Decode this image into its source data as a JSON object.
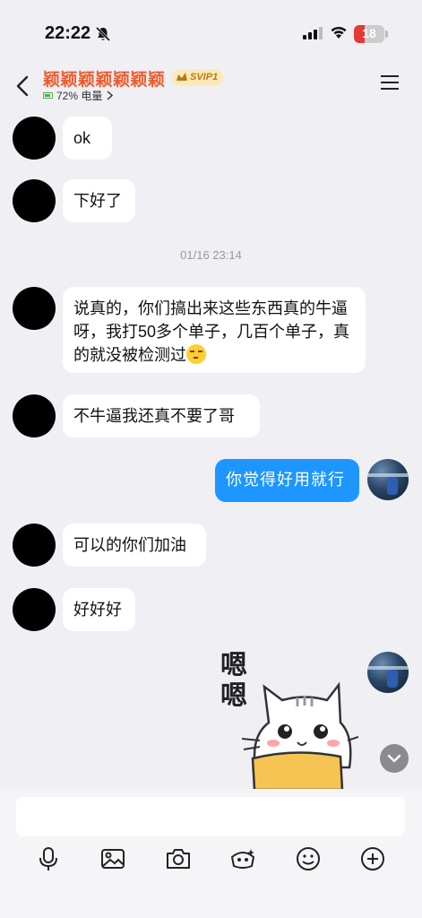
{
  "status_bar": {
    "time": "22:22",
    "battery": "18"
  },
  "header": {
    "title": "颖颖颖颖颖颖颖",
    "badge": "SVIP1",
    "subtitle_battery": "72% 电量"
  },
  "messages": [
    {
      "side": "left",
      "text": "ok"
    },
    {
      "side": "left",
      "text": "下好了"
    },
    {
      "side": "left",
      "text": "说真的，你们搞出来这些东西真的牛逼呀，我打50多个单子，几百个单子，真的就没被检测过"
    },
    {
      "side": "left",
      "text": "不牛逼我还真不要了哥"
    },
    {
      "side": "right",
      "text": "你觉得好用就行"
    },
    {
      "side": "left",
      "text": "可以的你们加油"
    },
    {
      "side": "left",
      "text": "好好好"
    }
  ],
  "timestamp": "01/16 23:14",
  "sticker": {
    "text": "嗯嗯"
  },
  "input": {
    "value": ""
  },
  "toolbar": [
    "microphone-icon",
    "image-icon",
    "camera-icon",
    "red-packet-icon",
    "emoji-icon",
    "plus-icon"
  ],
  "colors": {
    "title": "#ef5b2b",
    "self_bubble": "#1e96ff",
    "background": "#efeff4"
  }
}
